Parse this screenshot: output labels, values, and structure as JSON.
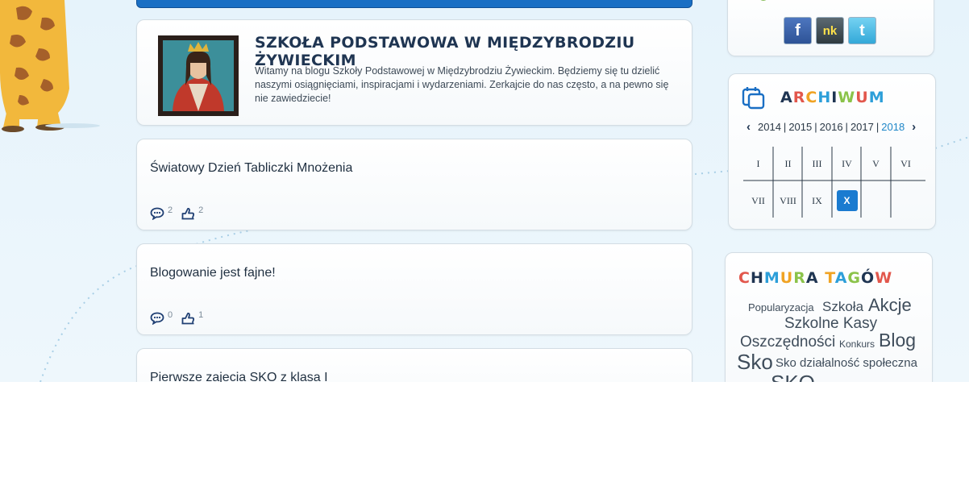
{
  "intro": {
    "title": "SZKOŁA PODSTAWOWA W MIĘDZYBRODZIU ŻYWIECKIM",
    "text": "Witamy na blogu Szkoły Podstawowej w Międzybrodziu Żywieckim. Będziemy się tu dzielić naszymi osiągnięciami, inspiracjami i wydarzeniami. Zerkajcie do nas często, a na pewno się nie zawiedziecie!"
  },
  "posts": [
    {
      "title": "Światowy Dzień Tabliczki Mnożenia",
      "comments": "2",
      "likes": "2"
    },
    {
      "title": "Blogowanie jest fajne!",
      "comments": "0",
      "likes": "1"
    },
    {
      "title": "Pierwsze zajecia SKO z klasa I"
    }
  ],
  "social": {
    "fb": "f",
    "nk": "nk",
    "tw": "t"
  },
  "archive": {
    "title": "ARCHIWUM",
    "years": [
      "2014",
      "2015",
      "2016",
      "2017",
      "2018"
    ],
    "active_year": "2018",
    "months": [
      "I",
      "II",
      "III",
      "IV",
      "V",
      "VI",
      "VII",
      "VIII",
      "IX",
      "X"
    ],
    "active_month": "X",
    "title_colors": [
      "#1f3552",
      "#e2574c",
      "#f0a323",
      "#2d9fd9",
      "#1f3552",
      "#8bc34a",
      "#e2574c",
      "#2d9fd9"
    ]
  },
  "tags": {
    "title": "CHMURA TAGÓW",
    "items": [
      "Popularyzacja",
      "Szkoła",
      "Akcje",
      "Szkolne Kasy",
      "Oszczędności",
      "Konkurs",
      "Blog",
      "Sko",
      "Sko działalność społeczna",
      "SKO"
    ],
    "title_colors": [
      "#e2574c",
      "#1f3552",
      "#2d9fd9",
      "#f0a323",
      "#8bc34a",
      "#1f3552",
      "#e2574c",
      "#f0a323",
      "#2d9fd9",
      "#8bc34a",
      "#1f3552",
      "#e2574c"
    ]
  },
  "colors": {
    "accent": "#1a6fc4",
    "active": "#1a7bd0"
  }
}
